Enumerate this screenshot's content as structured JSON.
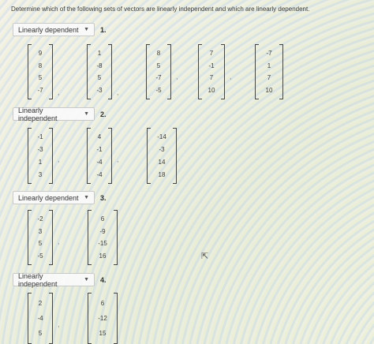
{
  "instructions": "Determine which of the following sets of vectors are linearly independent and which are linearly dependent.",
  "questions": [
    {
      "number": "1.",
      "answer": "Linearly dependent",
      "vectors": [
        [
          "9",
          "8",
          "5",
          "-7"
        ],
        [
          "1",
          "-8",
          "5",
          "-3"
        ],
        [
          "8",
          "5",
          "-7",
          "-5"
        ],
        [
          "7",
          "-1",
          "7",
          "10"
        ],
        [
          "-7",
          "1",
          "7",
          "10"
        ]
      ]
    },
    {
      "number": "2.",
      "answer": "Linearly independent",
      "vectors": [
        [
          "-1",
          "-3",
          "1",
          "3"
        ],
        [
          "4",
          "-1",
          "-4",
          "-4"
        ],
        [
          "-14",
          "-3",
          "14",
          "18"
        ]
      ]
    },
    {
      "number": "3.",
      "answer": "Linearly dependent",
      "vectors": [
        [
          "-2",
          "3",
          "5",
          "-5"
        ],
        [
          "6",
          "-9",
          "-15",
          "16"
        ]
      ]
    },
    {
      "number": "4.",
      "answer": "Linearly independent",
      "vectors": [
        [
          "2",
          "-4",
          "5"
        ],
        [
          "6",
          "-12",
          "15"
        ]
      ]
    }
  ],
  "icons": {
    "dropdown": "chevron-down-icon",
    "pointer": "mouse-cursor-icon"
  }
}
